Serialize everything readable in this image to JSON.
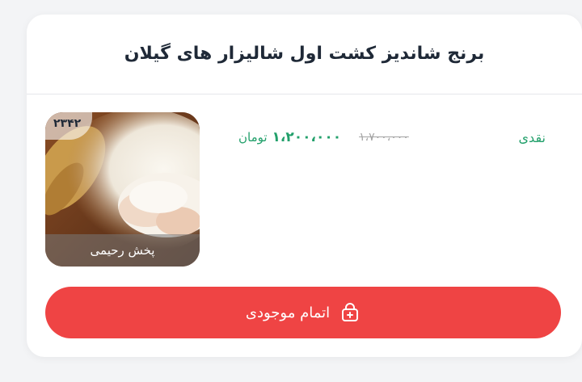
{
  "product": {
    "title": "برنج شاندیز کشت اول شالیزار های گیلان",
    "code": "۲۳۴۲",
    "seller": "پخش رحیمی",
    "payment_type": "نقدی",
    "price_old": "۱،۷۰۰،۰۰۰",
    "price_current": "۱،۲۰۰،۰۰۰",
    "currency": "تومان"
  },
  "cta": {
    "label": "اتمام موجودی",
    "icon": "bag-plus-icon"
  },
  "colors": {
    "accent_green": "#22a06b",
    "cta_red": "#ef4444"
  }
}
